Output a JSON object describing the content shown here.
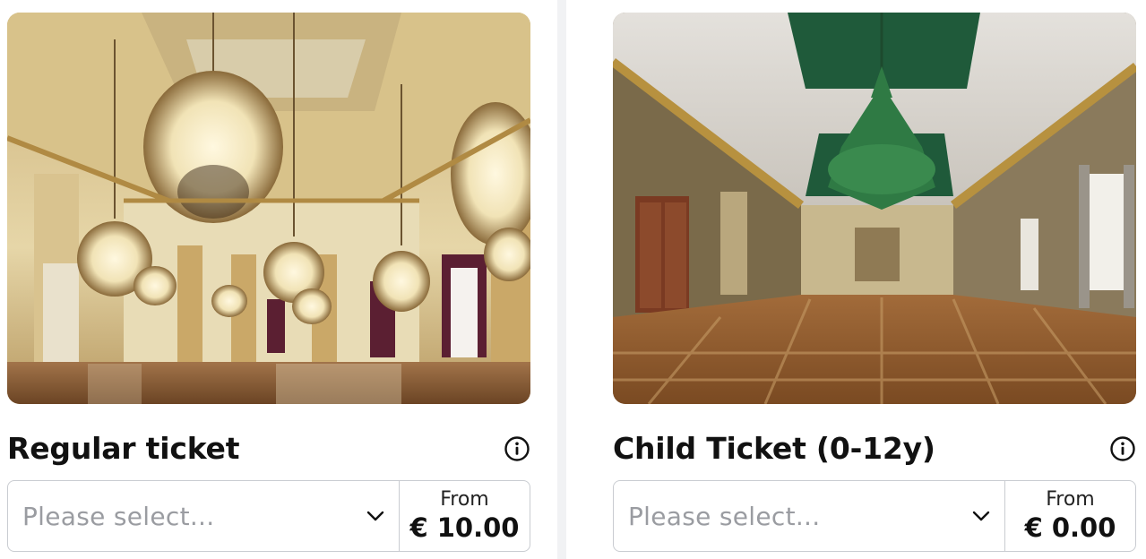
{
  "tickets": [
    {
      "title": "Regular ticket",
      "select_placeholder": "Please select...",
      "price_prefix": "From",
      "price": "€ 10.00",
      "image_alt": "Throne Room of the Royal Palace with gold walls and crystal chandeliers",
      "info_icon": "info-circle-icon",
      "dropdown_icon": "chevron-down-icon"
    },
    {
      "title": "Child Ticket (0-12y)",
      "select_placeholder": "Please select...",
      "price_prefix": "From",
      "price": "€ 0.00",
      "image_alt": "Mirror Room with green beetle-wing ceiling, green chandelier and parquet floor",
      "info_icon": "info-circle-icon",
      "dropdown_icon": "chevron-down-icon"
    }
  ],
  "colors": {
    "text": "#111111",
    "placeholder": "#9a9ca1",
    "border": "#c9ccd1",
    "divider": "#f1f2f4"
  }
}
